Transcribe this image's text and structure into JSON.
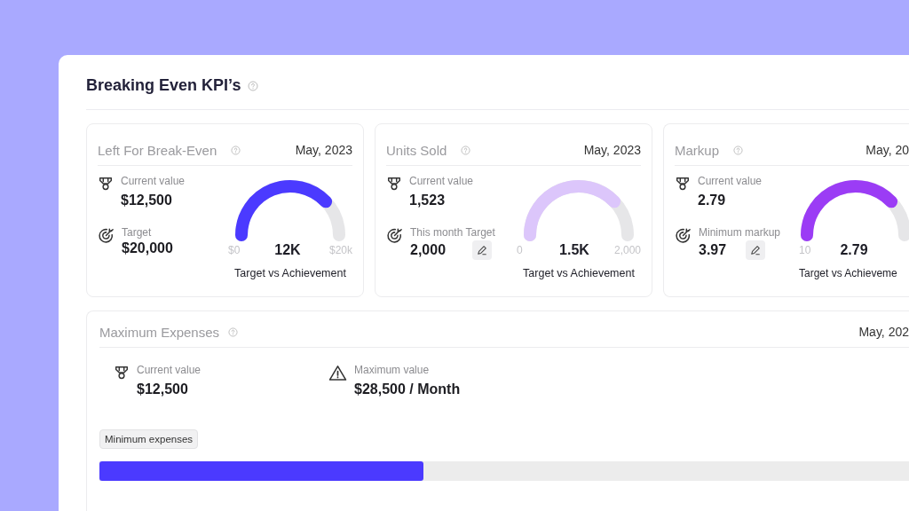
{
  "title": "Breaking Even KPI’s",
  "kpi_cards": [
    {
      "title": "Left For Break-Even",
      "date": "May, 2023",
      "current_label": "Current value",
      "current_value": "$12,500",
      "target_label": "Target",
      "target_value": "$20,000",
      "editable": false,
      "gauge": {
        "color": "#4b3aff",
        "min": "$0",
        "value": "12K",
        "max": "$20k",
        "caption": "Target vs Achievement"
      }
    },
    {
      "title": "Units Sold",
      "date": "May, 2023",
      "current_label": "Current value",
      "current_value": "1,523",
      "target_label": "This month Target",
      "target_value": "2,000",
      "editable": true,
      "gauge": {
        "color": "#dcc6fb",
        "min": "0",
        "value": "1.5K",
        "max": "2,000",
        "caption": "Target vs Achievement"
      }
    },
    {
      "title": "Markup",
      "date": "May, 20",
      "current_label": "Current value",
      "current_value": "2.79",
      "target_label": "Minimum markup",
      "target_value": "3.97",
      "editable": true,
      "gauge": {
        "color": "#9b3cf5",
        "min": "10",
        "value": "2.79",
        "caption": "Target vs Achieveme"
      }
    }
  ],
  "expenses": {
    "title": "Maximum Expenses",
    "date": "May, 202",
    "current_label": "Current value",
    "current_value": "$12,500",
    "max_label": "Maximum value",
    "max_value": "$28,500 / Month",
    "bar_label": "Minimum expenses",
    "level": 0.4
  }
}
